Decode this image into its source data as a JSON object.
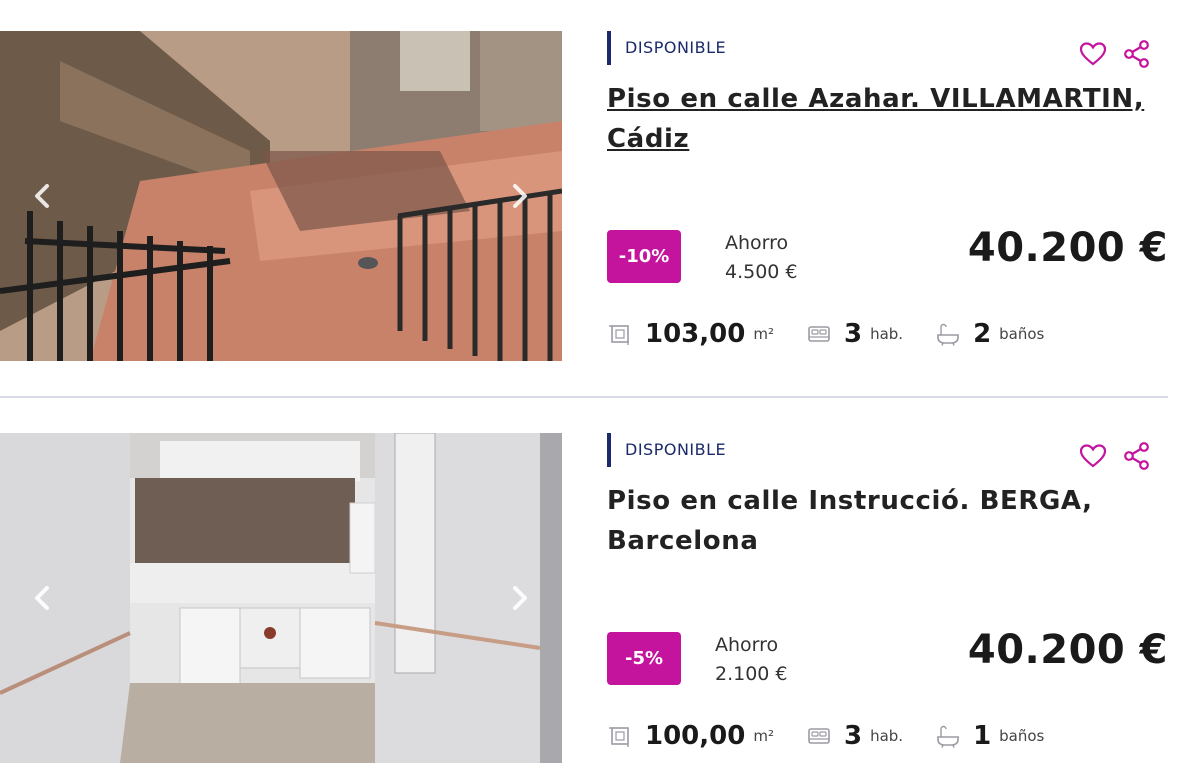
{
  "listings": [
    {
      "status": "DISPONIBLE",
      "title": "Piso en calle Azahar. VILLAMARTIN, Cádiz",
      "discount": "-10%",
      "saving_label": "Ahorro",
      "saving_value": "4.500 €",
      "price": "40.200 €",
      "area": "103,00",
      "area_unit": "m²",
      "rooms": "3",
      "rooms_unit": "hab.",
      "baths": "2",
      "baths_unit": "baños"
    },
    {
      "status": "DISPONIBLE",
      "title": "Piso en calle Instrucció. BERGA, Barcelona",
      "discount": "-5%",
      "saving_label": "Ahorro",
      "saving_value": "2.100 €",
      "price": "40.200 €",
      "area": "100,00",
      "area_unit": "m²",
      "rooms": "3",
      "rooms_unit": "hab.",
      "baths": "1",
      "baths_unit": "baños"
    }
  ],
  "colors": {
    "accent": "#c4139c",
    "status_bar": "#1b2a6b",
    "divider": "#d7dae4"
  },
  "icons": [
    "chevron-left-icon",
    "chevron-right-icon",
    "heart-icon",
    "share-icon",
    "area-icon",
    "bed-icon",
    "bath-icon"
  ]
}
